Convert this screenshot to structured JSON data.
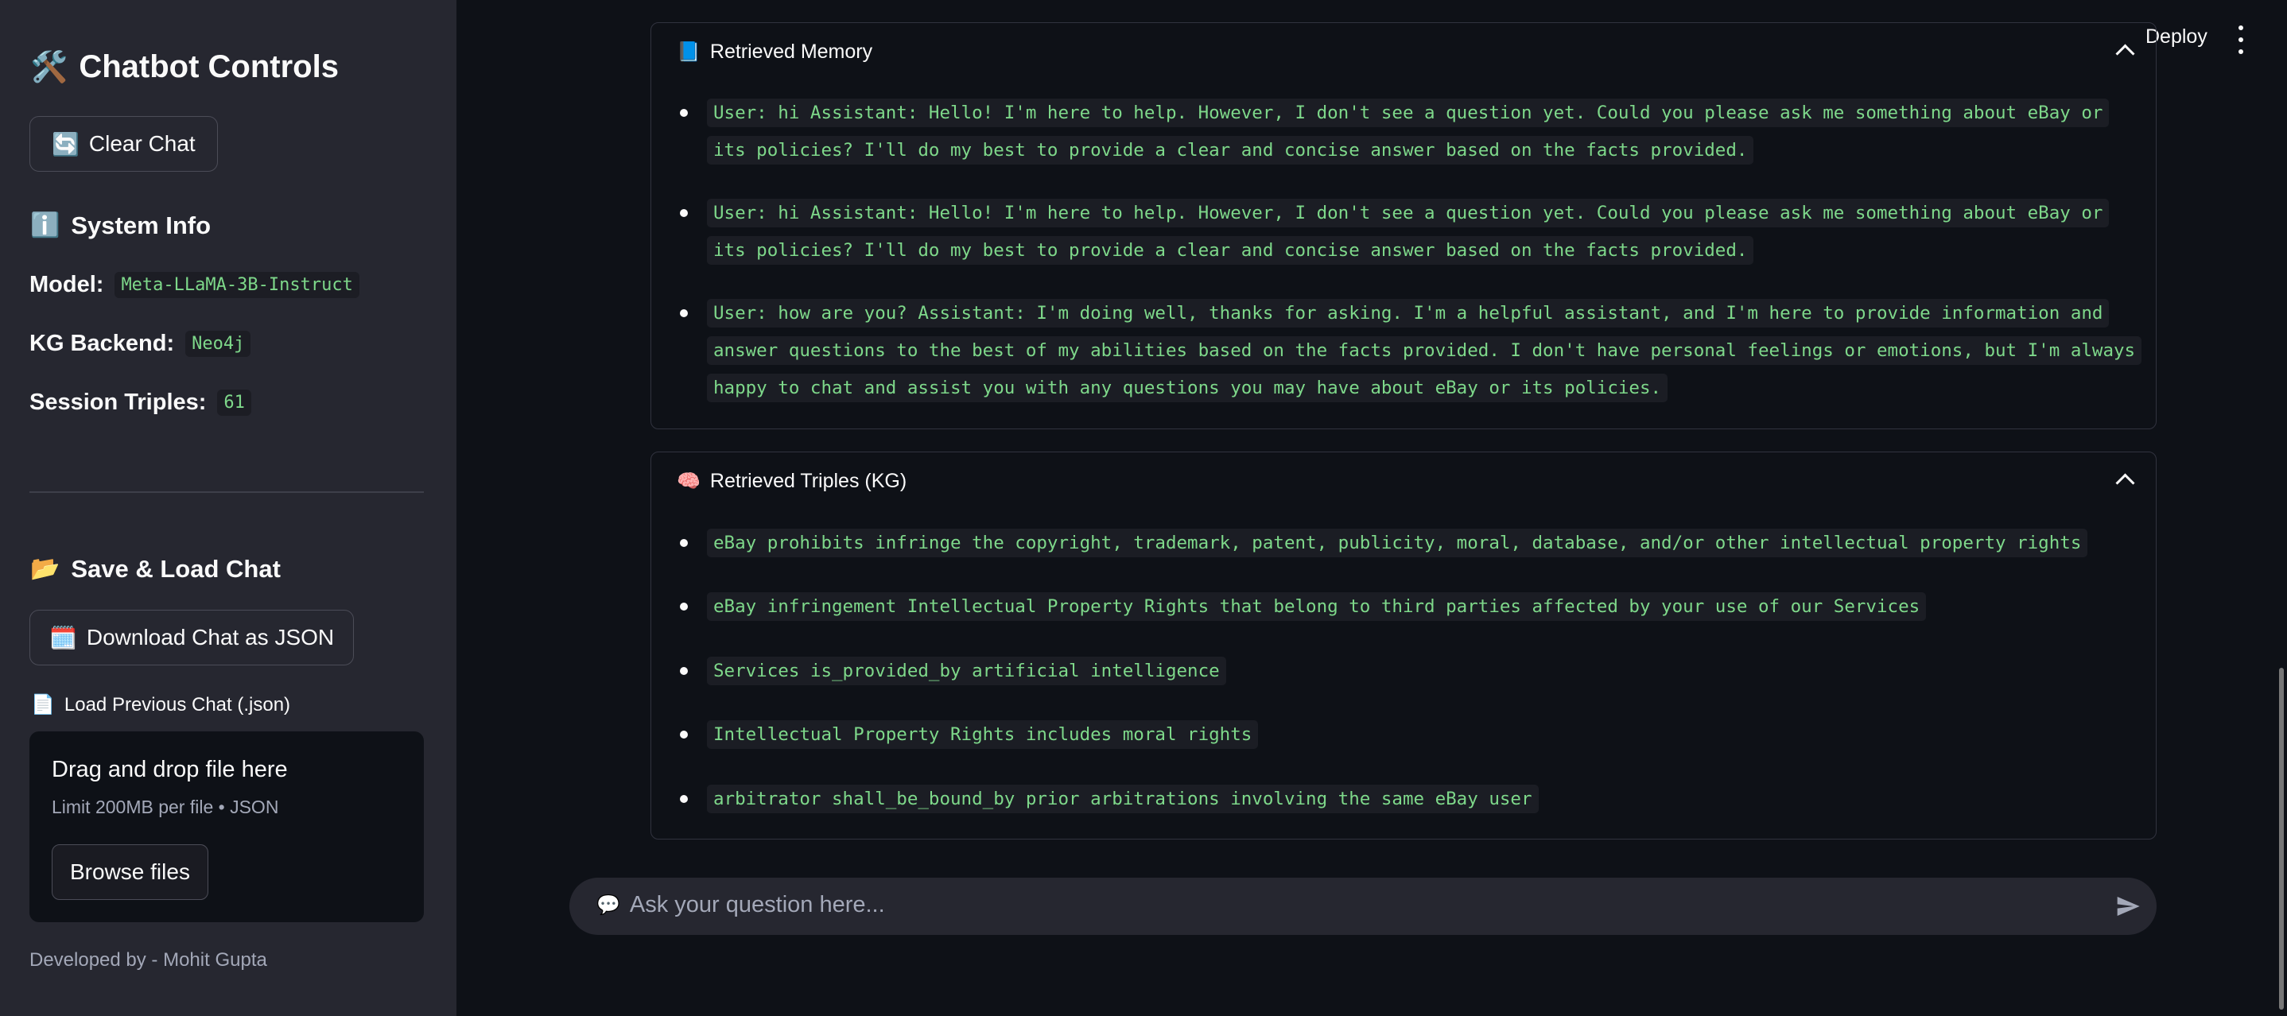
{
  "sidebar": {
    "title_emoji": "🛠️",
    "title": "Chatbot Controls",
    "clear_icon": "🔄",
    "clear_label": "Clear Chat",
    "system_emoji": "ℹ️",
    "system_title": "System Info",
    "model_label": "Model:",
    "model_value": "Meta-LLaMA-3B-Instruct",
    "kg_label": "KG Backend:",
    "kg_value": "Neo4j",
    "triples_label": "Session Triples:",
    "triples_value": "61",
    "save_emoji": "📂",
    "save_title": "Save & Load Chat",
    "download_icon": "🗓️",
    "download_label": "Download Chat as JSON",
    "load_icon": "📄",
    "load_label": "Load Previous Chat (.json)",
    "drop_title": "Drag and drop file here",
    "drop_limit": "Limit 200MB per file • JSON",
    "browse_label": "Browse files",
    "credit": "Developed by - Mohit Gupta"
  },
  "header": {
    "deploy_label": "Deploy"
  },
  "memory": {
    "icon": "📘",
    "title": "Retrieved Memory",
    "items": [
      "User: hi Assistant: Hello! I'm here to help. However, I don't see a question yet. Could you please ask me something about eBay or its policies? I'll do my best to provide a clear and concise answer based on the facts provided.",
      "User: hi Assistant: Hello! I'm here to help. However, I don't see a question yet. Could you please ask me something about eBay or its policies? I'll do my best to provide a clear and concise answer based on the facts provided.",
      "User: how are you? Assistant: I'm doing well, thanks for asking. I'm a helpful assistant, and I'm here to provide information and answer questions to the best of my abilities based on the facts provided. I don't have personal feelings or emotions, but I'm always happy to chat and assist you with any questions you may have about eBay or its policies."
    ]
  },
  "triples": {
    "icon": "🧠",
    "title": "Retrieved Triples (KG)",
    "items": [
      "eBay prohibits infringe the copyright, trademark, patent, publicity, moral, database, and/or other intellectual property rights",
      "eBay infringement Intellectual Property Rights that belong to third parties affected by your use of our Services",
      "Services is_provided_by artificial intelligence",
      "Intellectual Property Rights includes moral rights",
      "arbitrator shall_be_bound_by prior arbitrations involving the same eBay user"
    ]
  },
  "chat": {
    "icon": "💬",
    "placeholder": "Ask your question here..."
  }
}
